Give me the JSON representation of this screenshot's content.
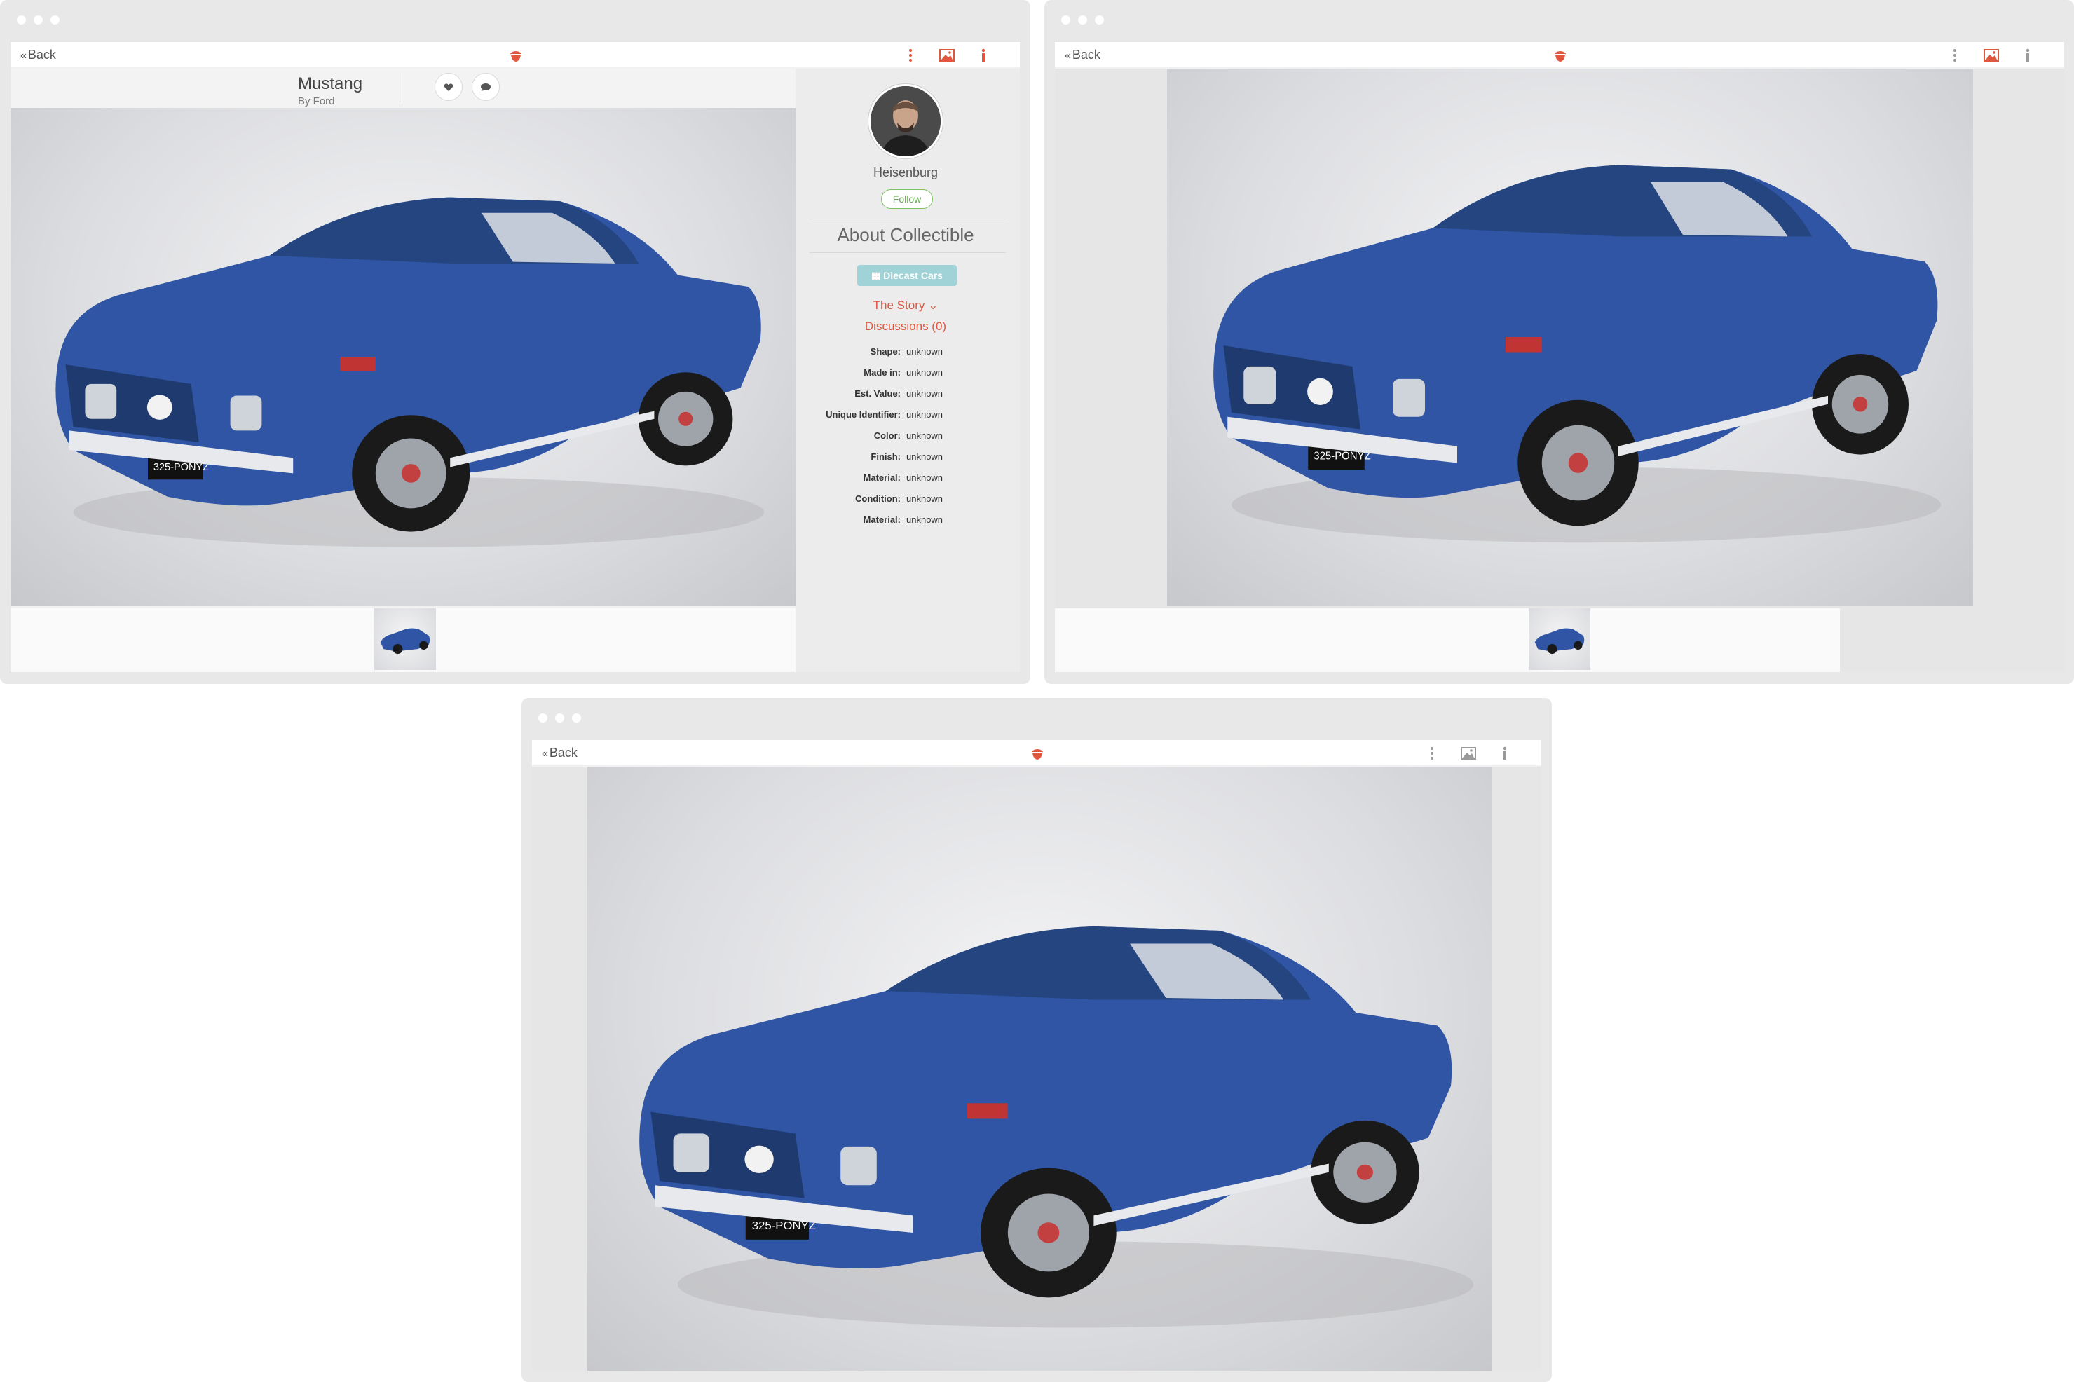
{
  "toolbar": {
    "back_label": "Back",
    "brand_color": "#e2553e"
  },
  "collectible": {
    "title": "Mustang",
    "subtitle": "By Ford"
  },
  "sidebar": {
    "username": "Heisenburg",
    "follow_label": "Follow",
    "about_heading": "About Collectible",
    "category": "Diecast Cars",
    "story_label": "The Story",
    "discussions_label": "Discussions (0)",
    "properties": [
      {
        "key": "Shape:",
        "value": "unknown"
      },
      {
        "key": "Made in:",
        "value": "unknown"
      },
      {
        "key": "Est. Value:",
        "value": "unknown"
      },
      {
        "key": "Unique Identifier:",
        "value": "unknown"
      },
      {
        "key": "Color:",
        "value": "unknown"
      },
      {
        "key": "Finish:",
        "value": "unknown"
      },
      {
        "key": "Material:",
        "value": "unknown"
      },
      {
        "key": "Condition:",
        "value": "unknown"
      },
      {
        "key": "Material:",
        "value": "unknown"
      }
    ]
  },
  "photo": {
    "plate_text": "325-PONYZ",
    "car_color": "#2f55a4"
  },
  "icons": {
    "back": "chevron-double-left-icon",
    "logo": "acorn-logo-icon",
    "more": "more-vertical-icon",
    "gallery": "image-icon",
    "info": "info-icon",
    "like": "heart-icon",
    "comment": "comment-icon"
  }
}
